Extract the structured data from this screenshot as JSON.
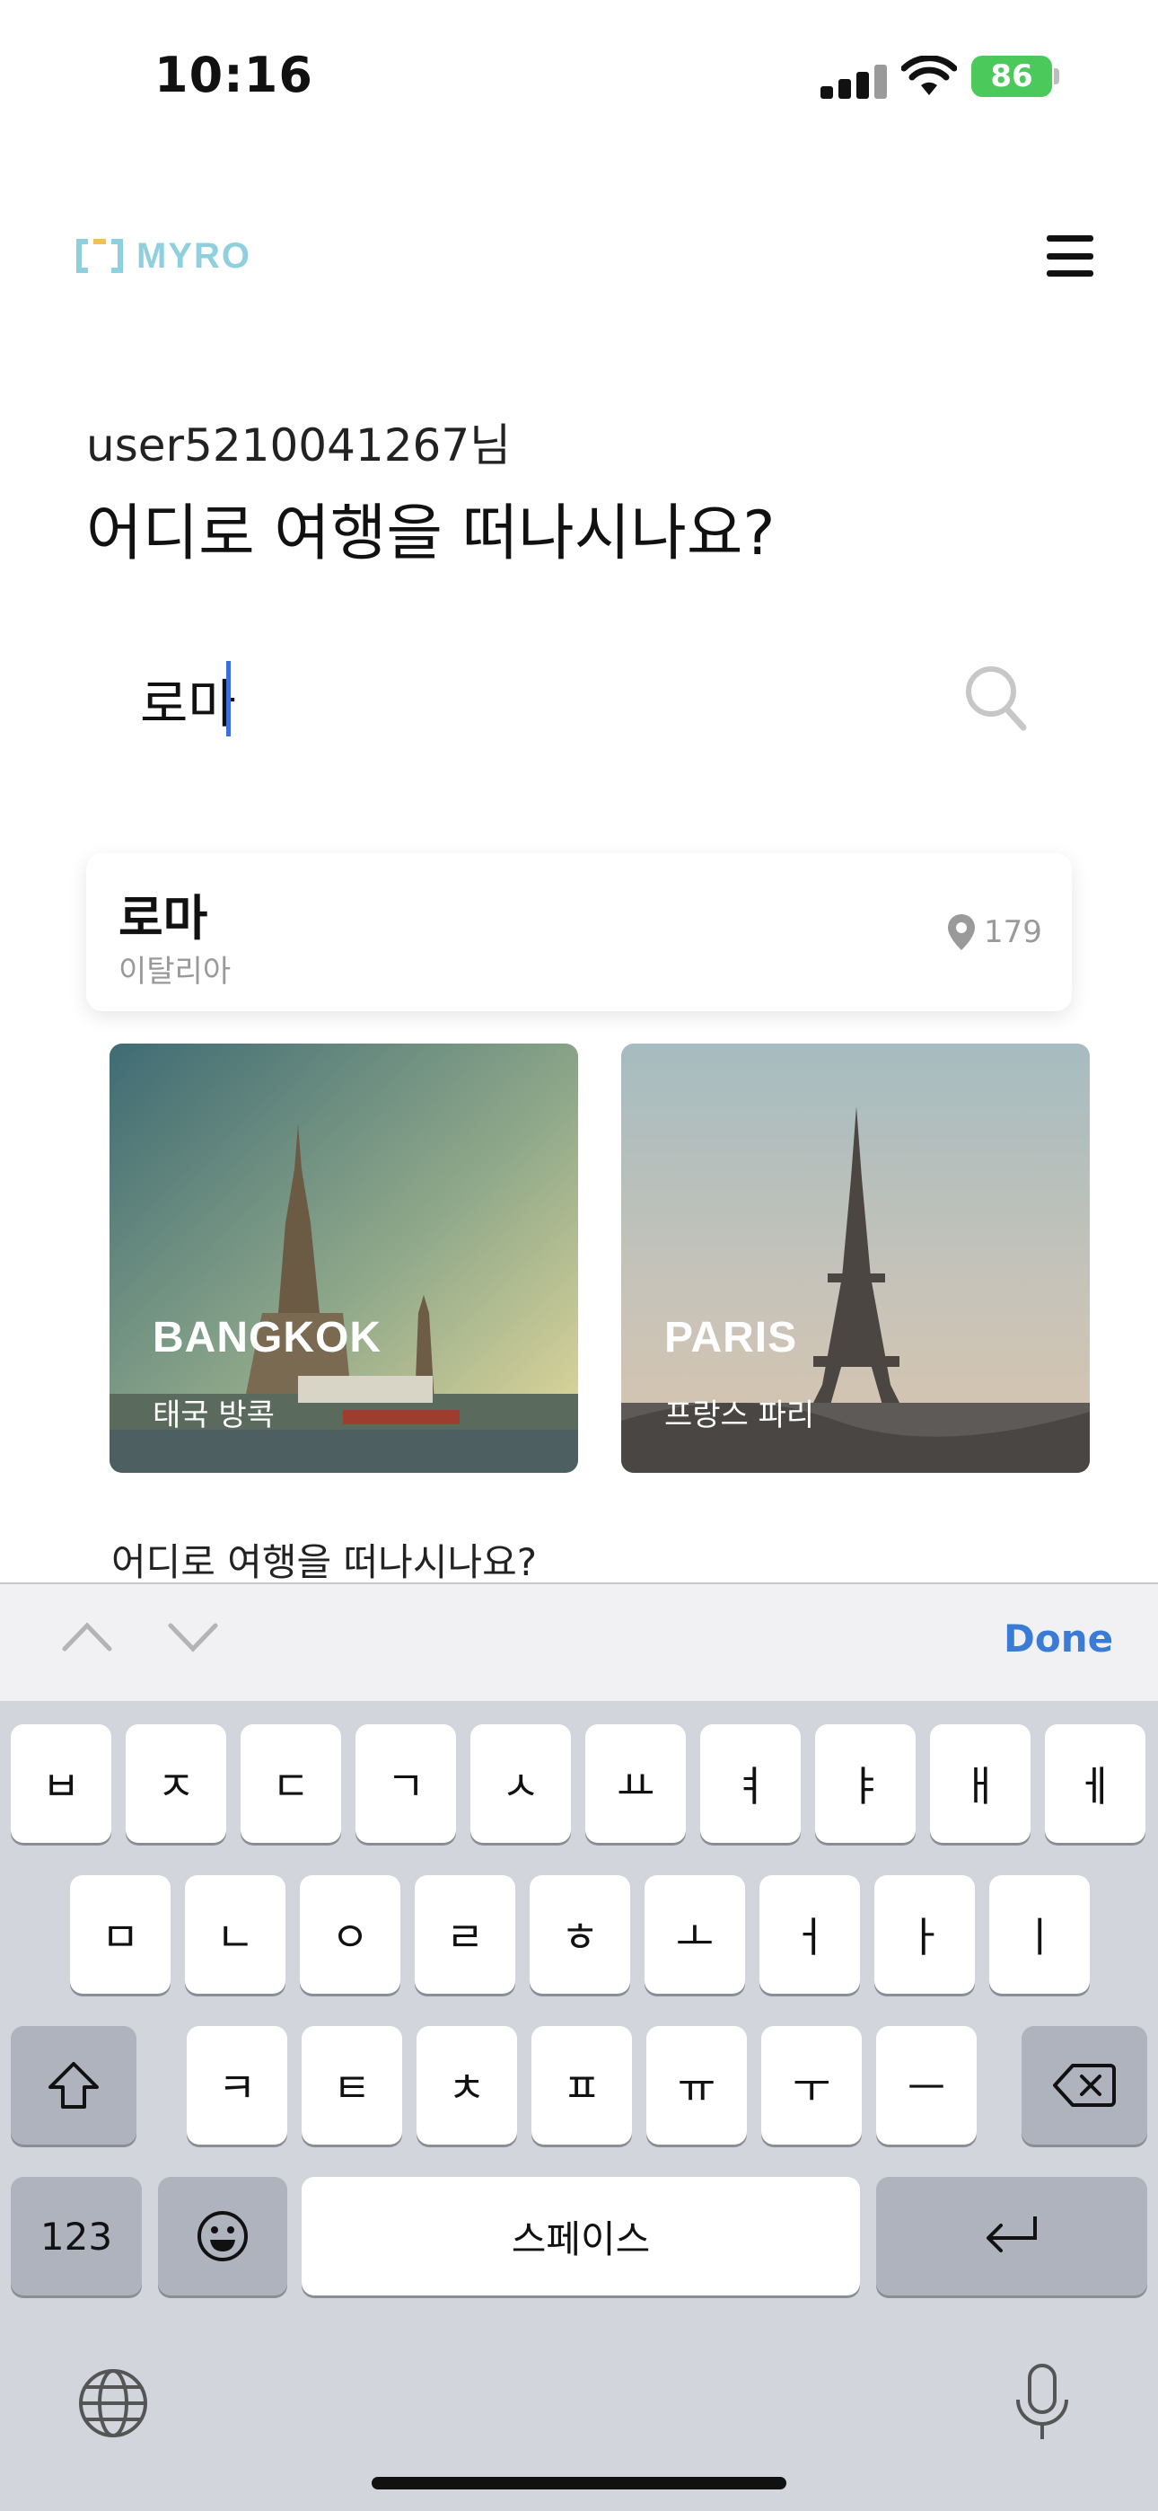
{
  "status_bar": {
    "time": "10:16",
    "battery": "86"
  },
  "header": {
    "logo_text": "MYRO"
  },
  "greeting": {
    "user": "user5210041267님",
    "headline": "어디로 여행을 떠나시나요?"
  },
  "search": {
    "value": "로마"
  },
  "suggestion": {
    "title": "로마",
    "country": "이탈리아",
    "count": "179"
  },
  "destinations": [
    {
      "name": "BANGKOK",
      "sub": "태국 방콕"
    },
    {
      "name": "PARIS",
      "sub": "프랑스 파리"
    }
  ],
  "section": {
    "title": "어디로 여행을 떠나시나요?"
  },
  "keyboard": {
    "done": "Done",
    "row1": [
      "ㅂ",
      "ㅈ",
      "ㄷ",
      "ㄱ",
      "ㅅ",
      "ㅛ",
      "ㅕ",
      "ㅑ",
      "ㅐ",
      "ㅔ"
    ],
    "row2": [
      "ㅁ",
      "ㄴ",
      "ㅇ",
      "ㄹ",
      "ㅎ",
      "ㅗ",
      "ㅓ",
      "ㅏ",
      "ㅣ"
    ],
    "row3": [
      "ㅋ",
      "ㅌ",
      "ㅊ",
      "ㅍ",
      "ㅠ",
      "ㅜ",
      "ㅡ"
    ],
    "numbers_key": "123",
    "space_key": "스페이스"
  },
  "colors": {
    "accent": "#3a7bd5",
    "logo": "#8fd0de",
    "keyboard_bg": "#d2d5db"
  }
}
